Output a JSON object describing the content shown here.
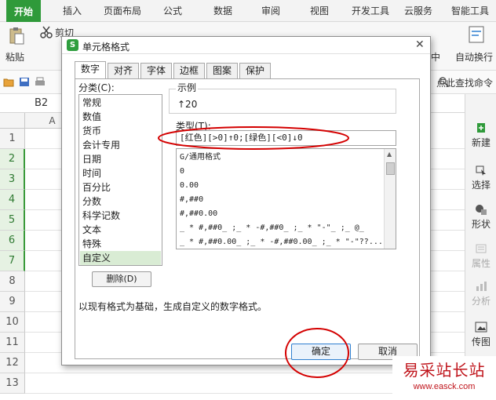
{
  "ribbon_tabs": [
    "开始",
    "插入",
    "页面布局",
    "公式",
    "数据",
    "审阅",
    "视图",
    "开发工具",
    "云服务",
    "智能工具"
  ],
  "ribbon": {
    "paste": "粘贴",
    "cut": "剪切",
    "center": "中",
    "wrap": "自动换行"
  },
  "quickbar": {
    "find_cmd": "点此查找命令"
  },
  "namebox": "B2",
  "column_headers": [
    "A"
  ],
  "row_numbers": [
    "1",
    "2",
    "3",
    "4",
    "5",
    "6",
    "7",
    "8",
    "9",
    "10",
    "11",
    "12",
    "13"
  ],
  "selected_rows": [
    "2",
    "3",
    "4",
    "5",
    "6",
    "7"
  ],
  "side_panel": [
    {
      "label": "新建",
      "icon": "new-icon",
      "enabled": true
    },
    {
      "label": "选择",
      "icon": "select-icon",
      "enabled": true
    },
    {
      "label": "形状",
      "icon": "shape-icon",
      "enabled": true
    },
    {
      "label": "属性",
      "icon": "properties-icon",
      "enabled": false
    },
    {
      "label": "分析",
      "icon": "analysis-icon",
      "enabled": false
    },
    {
      "label": "传图",
      "icon": "image-icon",
      "enabled": true
    }
  ],
  "dialog": {
    "title": "单元格格式",
    "tabs": [
      "数字",
      "对齐",
      "字体",
      "边框",
      "图案",
      "保护"
    ],
    "active_tab": "数字",
    "category_label": "分类(C):",
    "categories": [
      "常规",
      "数值",
      "货币",
      "会计专用",
      "日期",
      "时间",
      "百分比",
      "分数",
      "科学记数",
      "文本",
      "特殊",
      "自定义"
    ],
    "selected_category": "自定义",
    "sample_label": "示例",
    "sample_value": "↑20",
    "type_label": "类型(T):",
    "type_value": "[红色][>0]↑0;[绿色][<0]↓0",
    "formats": [
      "G/通用格式",
      "0",
      "0.00",
      "#,##0",
      "#,##0.00",
      "_ * #,##0_ ;_ * -#,##0_ ;_ * \"-\"_ ;_ @_",
      "_ * #,##0.00_ ;_ * -#,##0.00_ ;_ * \"-\"??..."
    ],
    "delete_button": "删除(D)",
    "description": "以现有格式为基础，生成自定义的数字格式。",
    "ok_button": "确定",
    "cancel_button": "取消"
  },
  "colors": {
    "accent_green": "#2f9a3a",
    "annotation_red": "#d40000",
    "ok_border": "#2f7fd0"
  },
  "watermark": {
    "title": "易采站长站",
    "url": "www.easck.com"
  }
}
